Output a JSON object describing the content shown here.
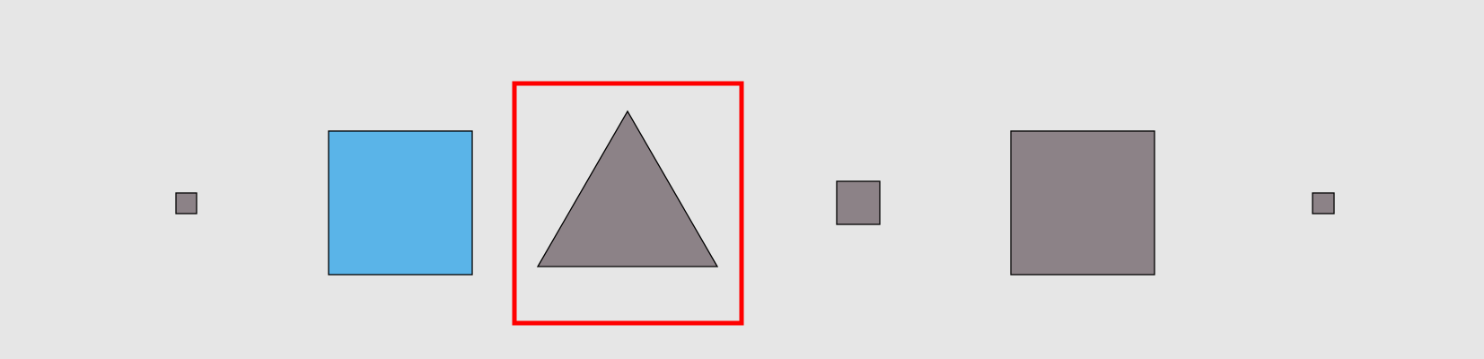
{
  "colors": {
    "background": "#e6e6e6",
    "gray_fill": "#8c8287",
    "blue_fill": "#5ab4e8",
    "outline": "#000000",
    "highlight": "#ff0000"
  },
  "shapes": [
    {
      "name": "small-square-left",
      "kind": "square",
      "fill": "gray_fill"
    },
    {
      "name": "blue-square",
      "kind": "square",
      "fill": "blue_fill"
    },
    {
      "name": "triangle",
      "kind": "triangle",
      "fill": "gray_fill",
      "highlighted": true
    },
    {
      "name": "medium-square",
      "kind": "square",
      "fill": "gray_fill"
    },
    {
      "name": "large-square",
      "kind": "square",
      "fill": "gray_fill"
    },
    {
      "name": "small-square-right",
      "kind": "square",
      "fill": "gray_fill"
    }
  ]
}
